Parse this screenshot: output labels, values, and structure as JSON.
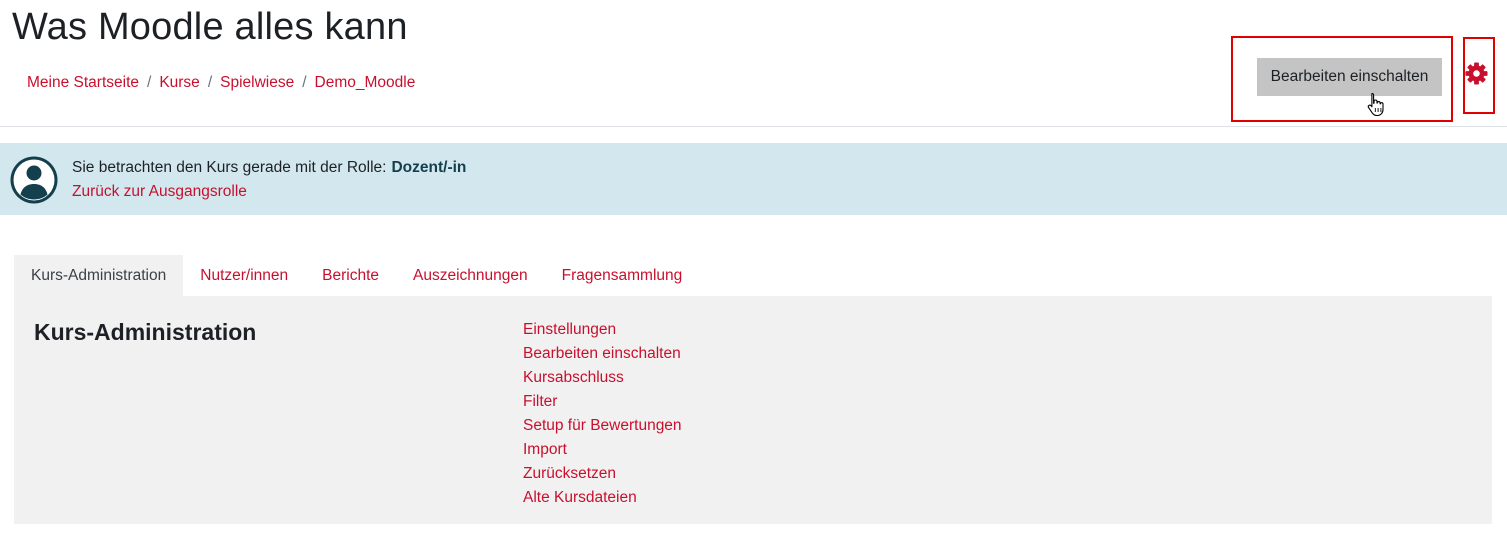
{
  "header": {
    "title": "Was Moodle alles kann",
    "breadcrumb": [
      "Meine Startseite",
      "Kurse",
      "Spielwiese",
      "Demo_Moodle"
    ],
    "separator": "/",
    "edit_button_label": "Bearbeiten einschalten"
  },
  "role_notice": {
    "text": "Sie betrachten den Kurs gerade mit der Rolle:",
    "role": "Dozent/-in",
    "back_link": "Zurück zur Ausgangsrolle"
  },
  "tabs": [
    {
      "label": "Kurs-Administration",
      "active": true
    },
    {
      "label": "Nutzer/innen",
      "active": false
    },
    {
      "label": "Berichte",
      "active": false
    },
    {
      "label": "Auszeichnungen",
      "active": false
    },
    {
      "label": "Fragensammlung",
      "active": false
    }
  ],
  "panel": {
    "title": "Kurs-Administration",
    "links": [
      "Einstellungen",
      "Bearbeiten einschalten",
      "Kursabschluss",
      "Filter",
      "Setup für Bewertungen",
      "Import",
      "Zurücksetzen",
      "Alte Kursdateien"
    ]
  },
  "colors": {
    "link": "#c8102e",
    "highlight_border": "#e00000",
    "role_bar": "#d2e8ee",
    "panel_bg": "#f1f1f1",
    "button_bg": "#c4c4c4"
  },
  "icons": {
    "settings": "gear-icon",
    "avatar": "user-avatar-icon",
    "cursor": "hand-pointer-cursor"
  }
}
